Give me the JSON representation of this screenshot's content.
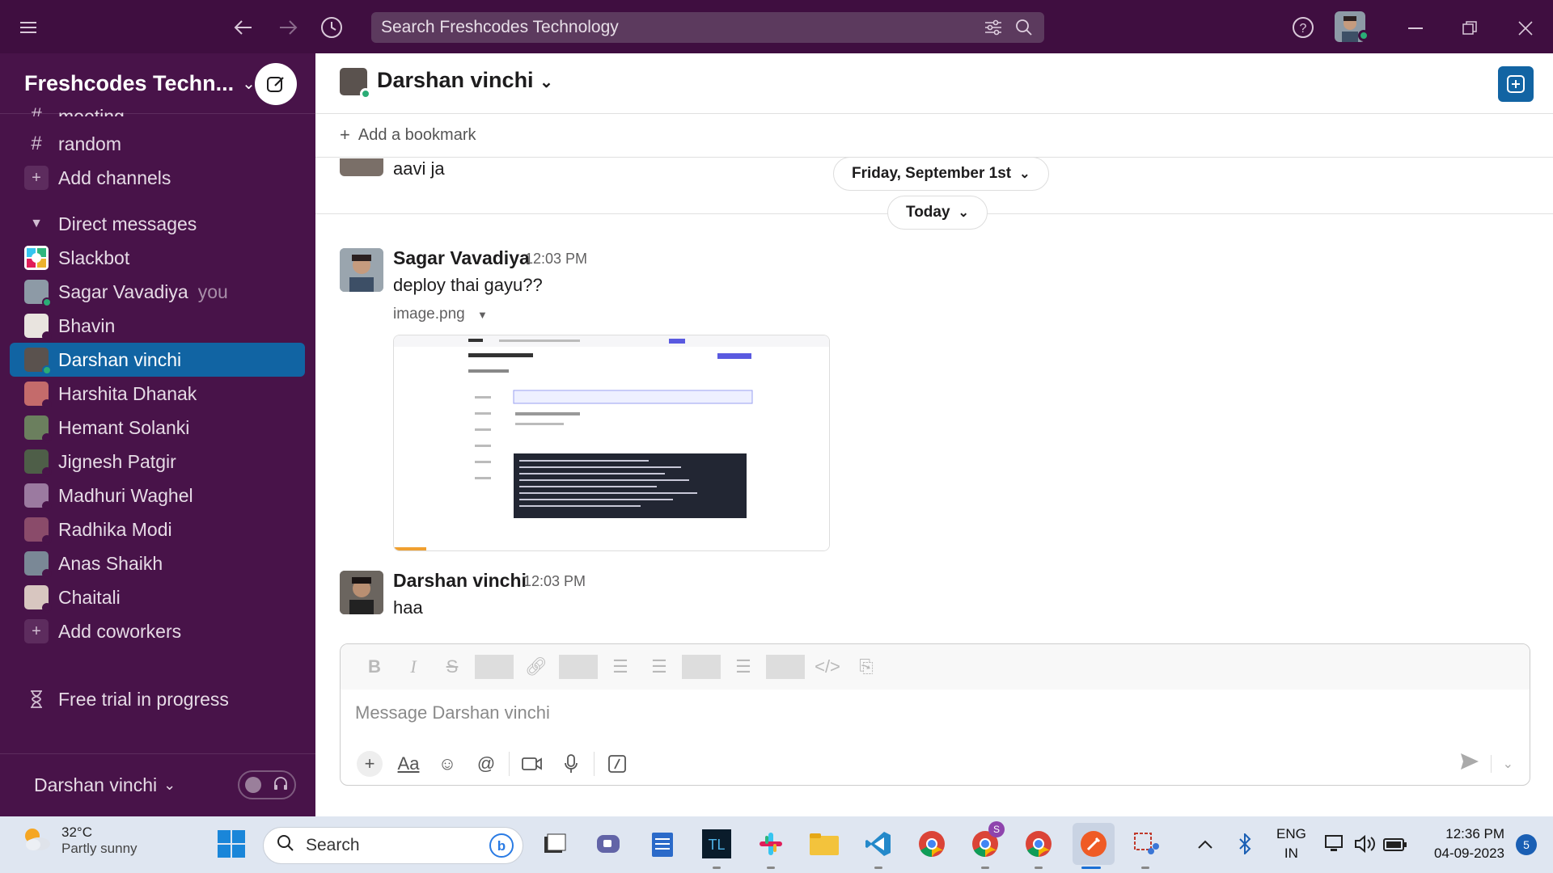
{
  "topbar": {
    "search_placeholder": "Search Freshcodes Technology",
    "colors": {
      "bg": "#3f0e40"
    }
  },
  "sidebar": {
    "workspace_name": "Freshcodes Techn...",
    "partial_channel": "meeting",
    "channels": [
      {
        "label": "random"
      }
    ],
    "add_channels": "Add channels",
    "dm_header": "Direct messages",
    "dms": [
      {
        "label": "Slackbot",
        "suffix": ""
      },
      {
        "label": "Sagar Vavadiya",
        "suffix": "you"
      },
      {
        "label": "Bhavin",
        "suffix": ""
      },
      {
        "label": "Darshan vinchi",
        "suffix": ""
      },
      {
        "label": "Harshita Dhanak",
        "suffix": ""
      },
      {
        "label": "Hemant Solanki",
        "suffix": ""
      },
      {
        "label": "Jignesh Patgir",
        "suffix": ""
      },
      {
        "label": "Madhuri Waghel",
        "suffix": ""
      },
      {
        "label": "Radhika Modi",
        "suffix": ""
      },
      {
        "label": "Anas Shaikh",
        "suffix": ""
      },
      {
        "label": "Chaitali",
        "suffix": ""
      }
    ],
    "add_coworkers": "Add coworkers",
    "free_trial": "Free trial in progress",
    "footer_user": "Darshan vinchi",
    "colors": {
      "bg": "#481349",
      "active": "#1164a3"
    }
  },
  "channel": {
    "title": "Darshan vinchi",
    "add_bookmark": "Add a bookmark"
  },
  "messages": {
    "partial_text": "aavi ja",
    "date_divider_1": "Friday, September 1st",
    "date_divider_2": "Today",
    "items": [
      {
        "author": "Sagar Vavadiya",
        "time": "12:03 PM",
        "text": "deploy thai gayu??",
        "attachment": "image.png"
      },
      {
        "author": "Darshan vinchi",
        "time": "12:03 PM",
        "text": "haa"
      }
    ]
  },
  "composer": {
    "placeholder": "Message Darshan vinchi"
  },
  "taskbar": {
    "temp": "32°C",
    "weather": "Partly sunny",
    "search_label": "Search",
    "lang_1": "ENG",
    "lang_2": "IN",
    "time": "12:36 PM",
    "date": "04-09-2023",
    "notif_count": "5",
    "chrome_badge": "S"
  }
}
